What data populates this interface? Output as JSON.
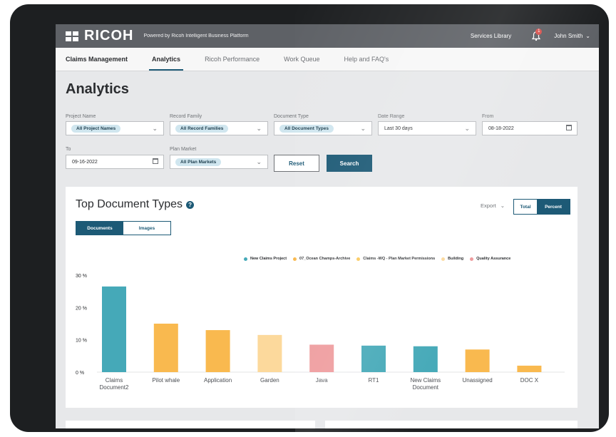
{
  "topbar": {
    "logo": "RICOH",
    "powered_by": "Powered by Ricoh Intelligent Business Platform",
    "services_library": "Services Library",
    "notification_count": "1",
    "user_name": "John Smith"
  },
  "nav": {
    "items": [
      "Claims Management",
      "Analytics",
      "Ricoh Performance",
      "Work Queue",
      "Help and FAQ's"
    ],
    "active": "Analytics"
  },
  "page_title": "Analytics",
  "filters": {
    "project_name": {
      "label": "Project Name",
      "value": "All Project Names"
    },
    "record_family": {
      "label": "Record Family",
      "value": "All Record Families"
    },
    "document_type": {
      "label": "Document Type",
      "value": "All Document Types"
    },
    "date_range": {
      "label": "Date Range",
      "value": "Last 30 days"
    },
    "from": {
      "label": "From",
      "value": "08-18-2022"
    },
    "to": {
      "label": "To",
      "value": "09-16-2022"
    },
    "plan_market": {
      "label": "Plan Market",
      "value": "All Plan Markets"
    },
    "reset_label": "Reset",
    "search_label": "Search"
  },
  "card": {
    "title": "Top Document Types",
    "help_icon": "?",
    "tab_documents": "Documents",
    "tab_images": "Images",
    "export_label": "Export",
    "toggle_total": "Total",
    "toggle_percent": "Percent"
  },
  "colors": {
    "brand": "#1d5a76",
    "topbar": "#5e6166",
    "teal": "#45a9b8",
    "orange": "#f9b94f",
    "gold": "#fbc95c",
    "peach": "#fcd99c",
    "pink": "#ee9a9c"
  },
  "chart_data": {
    "type": "bar",
    "legend": [
      {
        "name": "New Claims Project",
        "color": "#45a9b8"
      },
      {
        "name": "07_Ocean Champs-Archive",
        "color": "#f9b94f"
      },
      {
        "name": "Claims -WQ - Plan Market Permissions",
        "color": "#fbc95c"
      },
      {
        "name": "Building",
        "color": "#fcd99c"
      },
      {
        "name": "Quality Assurance",
        "color": "#ee9a9c"
      }
    ],
    "categories": [
      [
        "Claims",
        "Document2"
      ],
      [
        "Pilot whale"
      ],
      [
        "Application"
      ],
      [
        "Garden"
      ],
      [
        "Java"
      ],
      [
        "RT1"
      ],
      [
        "New Claims",
        "Document"
      ],
      [
        "Unassigned"
      ],
      [
        "DOC X"
      ]
    ],
    "values": [
      26.5,
      15,
      13,
      11.5,
      8.5,
      8.2,
      8,
      7,
      2
    ],
    "bar_colors": [
      "#45a9b8",
      "#f9b94f",
      "#f9b94f",
      "#fcd99c",
      "#ee9a9c",
      "#45a9b8",
      "#45a9b8",
      "#f9b94f",
      "#f9b94f"
    ],
    "yticks": [
      "0 %",
      "10 %",
      "20 %",
      "30 %"
    ],
    "ylim": [
      0,
      30
    ],
    "legend_position": "top-right",
    "grid": false
  }
}
